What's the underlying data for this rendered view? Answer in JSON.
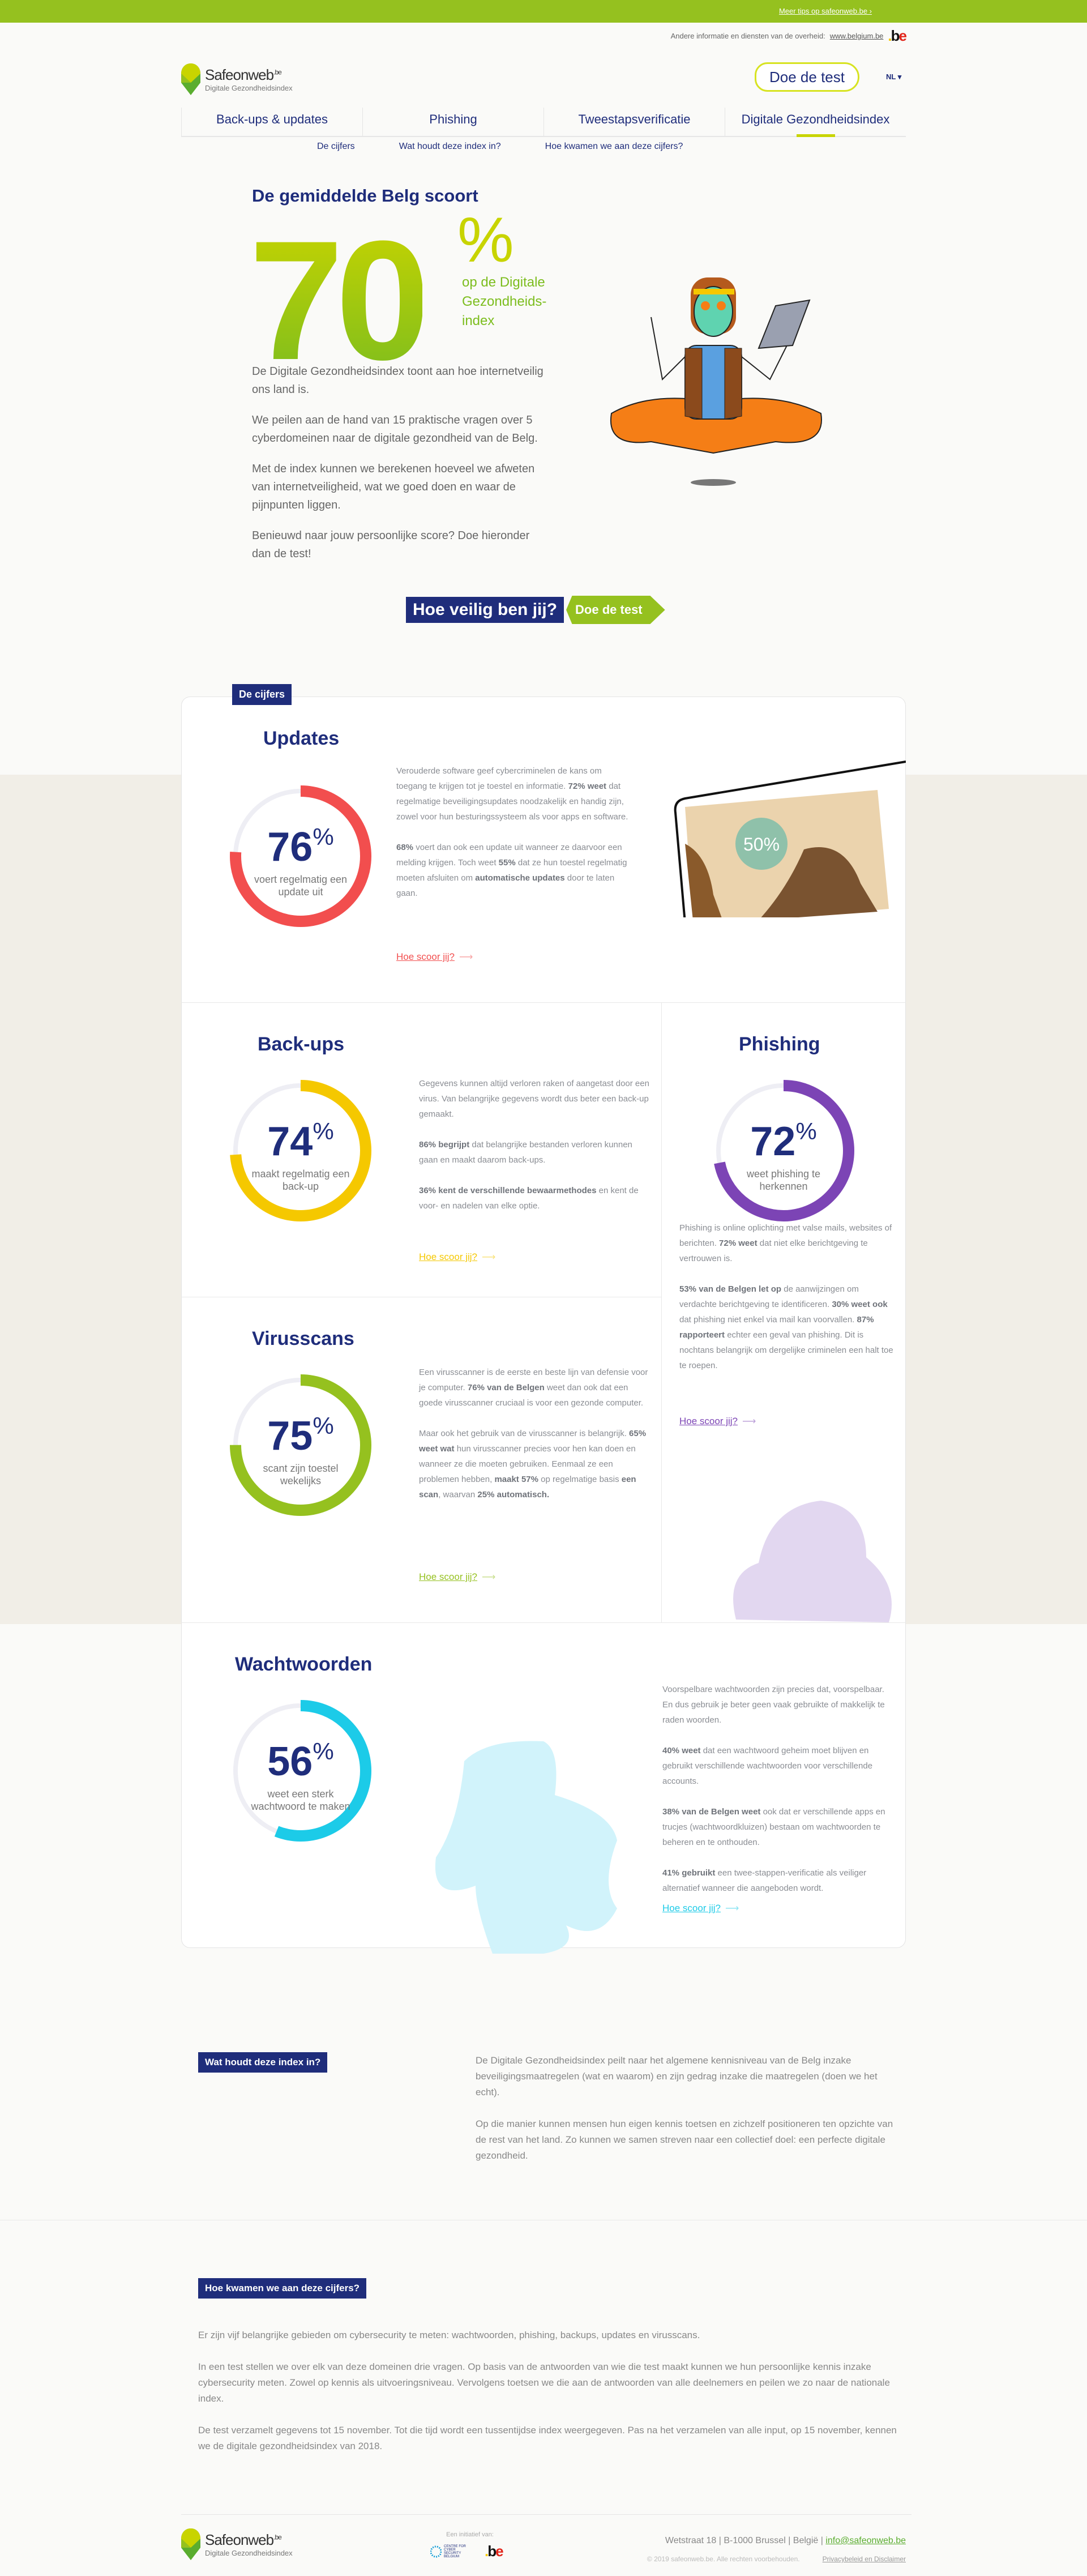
{
  "topbar": {
    "link": "Meer tips op safeonweb.be ›"
  },
  "gov": {
    "text": "Andere informatie en diensten van de overheid:",
    "link": "www.belgium.be",
    "logo": ".be"
  },
  "header": {
    "logo_name": "Safeonweb",
    "logo_tld": ".be",
    "logo_sub": "Digitale Gezondheidsindex",
    "test_button": "Doe de test",
    "lang": "NL ▾"
  },
  "nav": [
    {
      "label": "Back-ups & updates"
    },
    {
      "label": "Phishing"
    },
    {
      "label": "Tweestapsverificatie"
    },
    {
      "label": "Digitale Gezondheidsindex",
      "active": true
    }
  ],
  "subnav": [
    "De cijfers",
    "Wat houdt deze index in?",
    "Hoe kwamen we aan deze cijfers?"
  ],
  "hero": {
    "title": "De gemiddelde Belg scoort",
    "score": "70",
    "percent": "%",
    "score_caption": "op de Digitale Gezondheids-index",
    "paragraphs": [
      "De Digitale Gezondheidsindex toont aan hoe internetveilig ons land is.",
      "We peilen aan de hand van 15 praktische vragen over 5 cyberdomeinen naar de digitale gezondheid van de Belg.",
      "Met de index kunnen we berekenen hoeveel we afweten van internetveiligheid, wat we goed doen en waar de pijnpunten liggen.",
      "Benieuwd naar jouw persoonlijke score? Doe hieronder dan de test!"
    ],
    "cta_question": "Hoe veilig ben jij?",
    "cta_button": "Doe de test"
  },
  "cijfers": {
    "tag": "De cijfers",
    "track_color": "#eeeef4",
    "sections": [
      {
        "id": "updates",
        "title": "Updates",
        "value": 76,
        "caption": "voert regelmatig een update uit",
        "color": "#f24e4e",
        "image_text": "50%",
        "paragraphs": [
          [
            {
              "t": "Verouderde software geef cybercriminelen de kans om toegang te krijgen tot je toestel en informatie. "
            },
            {
              "t": "72% weet",
              "b": true
            },
            {
              "t": " dat regelmatige beveiligingsupdates noodzakelijk en handig zijn, zowel voor hun besturingssysteem als voor apps en software."
            }
          ],
          [
            {
              "t": "68%",
              "b": true
            },
            {
              "t": " voert dan ook een update uit wanneer ze daarvoor een melding krijgen. Toch weet "
            },
            {
              "t": "55%",
              "b": true
            },
            {
              "t": " dat ze hun toestel regelmatig moeten afsluiten om "
            },
            {
              "t": "automatische updates",
              "b": true
            },
            {
              "t": " door te laten gaan."
            }
          ]
        ],
        "link": "Hoe scoor jij?"
      },
      {
        "id": "backups",
        "title": "Back-ups",
        "value": 74,
        "caption": "maakt regelmatig een back-up",
        "color": "#f5c800",
        "paragraphs": [
          [
            {
              "t": "Gegevens kunnen altijd verloren raken of aangetast door een virus. Van belangrijke gegevens wordt dus beter een back-up gemaakt."
            }
          ],
          [
            {
              "t": "86% begrijpt",
              "b": true
            },
            {
              "t": " dat belangrijke bestanden verloren kunnen gaan en maakt daarom back-ups."
            }
          ],
          [
            {
              "t": "36% kent de verschillende bewaarmethodes",
              "b": true
            },
            {
              "t": " en kent de voor- en nadelen van elke optie."
            }
          ]
        ],
        "link": "Hoe scoor jij?"
      },
      {
        "id": "phishing",
        "title": "Phishing",
        "value": 72,
        "caption": "weet phishing te herkennen",
        "color": "#7c44b5",
        "paragraphs": [
          [
            {
              "t": "Phishing is online oplichting met valse mails, websites of berichten. "
            },
            {
              "t": "72% weet",
              "b": true
            },
            {
              "t": " dat niet elke berichtgeving te vertrouwen is."
            }
          ],
          [
            {
              "t": "53% van de Belgen let op",
              "b": true
            },
            {
              "t": " de aanwijzingen om verdachte berichtgeving te identificeren. "
            },
            {
              "t": "30% weet ook",
              "b": true
            },
            {
              "t": " dat phishing niet enkel via mail kan voorvallen. "
            },
            {
              "t": "87% rapporteert",
              "b": true
            },
            {
              "t": " echter een geval van phishing. Dit is nochtans belangrijk om dergelijke criminelen een halt toe te roepen."
            }
          ]
        ],
        "link": "Hoe scoor jij?"
      },
      {
        "id": "virusscans",
        "title": "Virusscans",
        "value": 75,
        "caption": "scant zijn toestel wekelijks",
        "color": "#95c11f",
        "paragraphs": [
          [
            {
              "t": "Een virusscanner is de eerste en beste lijn van defensie voor je computer. "
            },
            {
              "t": "76% van de Belgen",
              "b": true
            },
            {
              "t": " weet dan ook dat een goede virusscanner cruciaal is voor een gezonde computer."
            }
          ],
          [
            {
              "t": "Maar ook het gebruik van de virusscanner is belangrijk. "
            },
            {
              "t": "65% weet wat",
              "b": true
            },
            {
              "t": " hun virusscanner precies voor hen kan doen en wanneer ze die moeten gebruiken. Eenmaal ze een problemen hebben, "
            },
            {
              "t": "maakt 57%",
              "b": true
            },
            {
              "t": " op regelmatige basis "
            },
            {
              "t": "een scan",
              "b": true
            },
            {
              "t": ", waarvan "
            },
            {
              "t": "25% automatisch.",
              "b": true
            }
          ]
        ],
        "link": "Hoe scoor jij?"
      },
      {
        "id": "wachtwoorden",
        "title": "Wachtwoorden",
        "value": 56,
        "caption": "weet een sterk wachtwoord te maken",
        "color": "#1ccbe8",
        "paragraphs": [
          [
            {
              "t": "Voorspelbare wachtwoorden zijn precies dat, voorspelbaar. En dus gebruik je beter geen vaak gebruikte of makkelijk te raden woorden."
            }
          ],
          [
            {
              "t": "40% weet",
              "b": true
            },
            {
              "t": " dat een wachtwoord geheim moet blijven en gebruikt verschillende wachtwoorden voor verschillende accounts."
            }
          ],
          [
            {
              "t": "38% van de Belgen weet",
              "b": true
            },
            {
              "t": " ook dat er verschillende apps en trucjes (wachtwoordkluizen) bestaan om wachtwoorden te beheren en te onthouden."
            }
          ],
          [
            {
              "t": "41% gebruikt",
              "b": true
            },
            {
              "t": " een twee-stappen-verificatie als veiliger alternatief wanneer die aangeboden wordt."
            }
          ]
        ],
        "link": "Hoe scoor jij?"
      }
    ]
  },
  "about": {
    "tag": "Wat houdt deze index in?",
    "paragraphs": [
      "De Digitale Gezondheidsindex peilt naar het algemene kennisniveau van de Belg inzake beveiligingsmaatregelen (wat en waarom) en zijn gedrag inzake die maatregelen (doen we het echt).",
      "Op die manier kunnen mensen hun eigen kennis toetsen en zichzelf positioneren ten opzichte van de rest van het land. Zo kunnen we samen streven naar een collectief doel: een perfecte digitale gezondheid."
    ]
  },
  "method": {
    "tag": "Hoe kwamen we aan deze cijfers?",
    "paragraphs": [
      "Er zijn vijf belangrijke gebieden om cybersecurity te meten: wachtwoorden, phishing, backups, updates en virusscans.",
      "In een test stellen we over elk van deze domeinen drie vragen. Op basis van de antwoorden van wie die test maakt kunnen we hun persoonlijke kennis inzake cybersecurity meten. Zowel op kennis als uitvoeringsniveau. Vervolgens toetsen we die aan de antwoorden van alle deelnemers en peilen we zo naar de nationale index.",
      "De test verzamelt gegevens tot 15 november. Tot die tijd wordt een tussentijdse index weergegeven. Pas na het verzamelen van alle input, op 15 november, kennen we de digitale gezondheidsindex van 2018."
    ]
  },
  "footer": {
    "initiative": "Een initiatief van:",
    "ccb": "CENTRE FOR CYBER SECURITY BELGIUM",
    "address": "Wetstraat 18 | B-1000 Brussel | België |",
    "email": "info@safeonweb.be",
    "copyright": "© 2019 safeonweb.be. Alle rechten voorbehouden.",
    "privacy": "Privacybeleid en Disclaimer"
  },
  "colors": {
    "navy": "#1f2d7b",
    "green": "#95c11f",
    "lime": "#c8d400"
  }
}
